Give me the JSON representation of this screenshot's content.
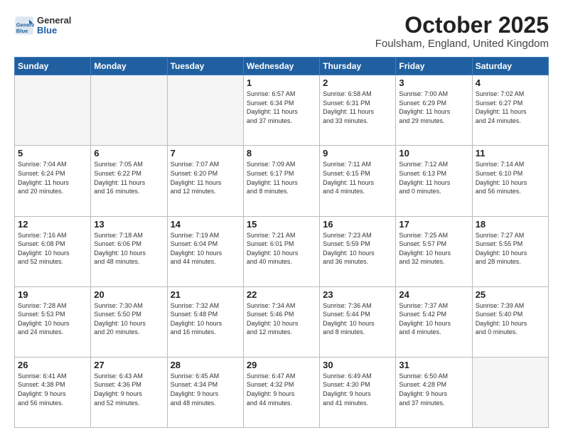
{
  "header": {
    "logo": {
      "general": "General",
      "blue": "Blue"
    },
    "title": "October 2025",
    "location": "Foulsham, England, United Kingdom"
  },
  "days_of_week": [
    "Sunday",
    "Monday",
    "Tuesday",
    "Wednesday",
    "Thursday",
    "Friday",
    "Saturday"
  ],
  "weeks": [
    [
      {
        "day": "",
        "info": ""
      },
      {
        "day": "",
        "info": ""
      },
      {
        "day": "",
        "info": ""
      },
      {
        "day": "1",
        "info": "Sunrise: 6:57 AM\nSunset: 6:34 PM\nDaylight: 11 hours\nand 37 minutes."
      },
      {
        "day": "2",
        "info": "Sunrise: 6:58 AM\nSunset: 6:31 PM\nDaylight: 11 hours\nand 33 minutes."
      },
      {
        "day": "3",
        "info": "Sunrise: 7:00 AM\nSunset: 6:29 PM\nDaylight: 11 hours\nand 29 minutes."
      },
      {
        "day": "4",
        "info": "Sunrise: 7:02 AM\nSunset: 6:27 PM\nDaylight: 11 hours\nand 24 minutes."
      }
    ],
    [
      {
        "day": "5",
        "info": "Sunrise: 7:04 AM\nSunset: 6:24 PM\nDaylight: 11 hours\nand 20 minutes."
      },
      {
        "day": "6",
        "info": "Sunrise: 7:05 AM\nSunset: 6:22 PM\nDaylight: 11 hours\nand 16 minutes."
      },
      {
        "day": "7",
        "info": "Sunrise: 7:07 AM\nSunset: 6:20 PM\nDaylight: 11 hours\nand 12 minutes."
      },
      {
        "day": "8",
        "info": "Sunrise: 7:09 AM\nSunset: 6:17 PM\nDaylight: 11 hours\nand 8 minutes."
      },
      {
        "day": "9",
        "info": "Sunrise: 7:11 AM\nSunset: 6:15 PM\nDaylight: 11 hours\nand 4 minutes."
      },
      {
        "day": "10",
        "info": "Sunrise: 7:12 AM\nSunset: 6:13 PM\nDaylight: 11 hours\nand 0 minutes."
      },
      {
        "day": "11",
        "info": "Sunrise: 7:14 AM\nSunset: 6:10 PM\nDaylight: 10 hours\nand 56 minutes."
      }
    ],
    [
      {
        "day": "12",
        "info": "Sunrise: 7:16 AM\nSunset: 6:08 PM\nDaylight: 10 hours\nand 52 minutes."
      },
      {
        "day": "13",
        "info": "Sunrise: 7:18 AM\nSunset: 6:06 PM\nDaylight: 10 hours\nand 48 minutes."
      },
      {
        "day": "14",
        "info": "Sunrise: 7:19 AM\nSunset: 6:04 PM\nDaylight: 10 hours\nand 44 minutes."
      },
      {
        "day": "15",
        "info": "Sunrise: 7:21 AM\nSunset: 6:01 PM\nDaylight: 10 hours\nand 40 minutes."
      },
      {
        "day": "16",
        "info": "Sunrise: 7:23 AM\nSunset: 5:59 PM\nDaylight: 10 hours\nand 36 minutes."
      },
      {
        "day": "17",
        "info": "Sunrise: 7:25 AM\nSunset: 5:57 PM\nDaylight: 10 hours\nand 32 minutes."
      },
      {
        "day": "18",
        "info": "Sunrise: 7:27 AM\nSunset: 5:55 PM\nDaylight: 10 hours\nand 28 minutes."
      }
    ],
    [
      {
        "day": "19",
        "info": "Sunrise: 7:28 AM\nSunset: 5:53 PM\nDaylight: 10 hours\nand 24 minutes."
      },
      {
        "day": "20",
        "info": "Sunrise: 7:30 AM\nSunset: 5:50 PM\nDaylight: 10 hours\nand 20 minutes."
      },
      {
        "day": "21",
        "info": "Sunrise: 7:32 AM\nSunset: 5:48 PM\nDaylight: 10 hours\nand 16 minutes."
      },
      {
        "day": "22",
        "info": "Sunrise: 7:34 AM\nSunset: 5:46 PM\nDaylight: 10 hours\nand 12 minutes."
      },
      {
        "day": "23",
        "info": "Sunrise: 7:36 AM\nSunset: 5:44 PM\nDaylight: 10 hours\nand 8 minutes."
      },
      {
        "day": "24",
        "info": "Sunrise: 7:37 AM\nSunset: 5:42 PM\nDaylight: 10 hours\nand 4 minutes."
      },
      {
        "day": "25",
        "info": "Sunrise: 7:39 AM\nSunset: 5:40 PM\nDaylight: 10 hours\nand 0 minutes."
      }
    ],
    [
      {
        "day": "26",
        "info": "Sunrise: 6:41 AM\nSunset: 4:38 PM\nDaylight: 9 hours\nand 56 minutes."
      },
      {
        "day": "27",
        "info": "Sunrise: 6:43 AM\nSunset: 4:36 PM\nDaylight: 9 hours\nand 52 minutes."
      },
      {
        "day": "28",
        "info": "Sunrise: 6:45 AM\nSunset: 4:34 PM\nDaylight: 9 hours\nand 48 minutes."
      },
      {
        "day": "29",
        "info": "Sunrise: 6:47 AM\nSunset: 4:32 PM\nDaylight: 9 hours\nand 44 minutes."
      },
      {
        "day": "30",
        "info": "Sunrise: 6:49 AM\nSunset: 4:30 PM\nDaylight: 9 hours\nand 41 minutes."
      },
      {
        "day": "31",
        "info": "Sunrise: 6:50 AM\nSunset: 4:28 PM\nDaylight: 9 hours\nand 37 minutes."
      },
      {
        "day": "",
        "info": ""
      }
    ]
  ]
}
